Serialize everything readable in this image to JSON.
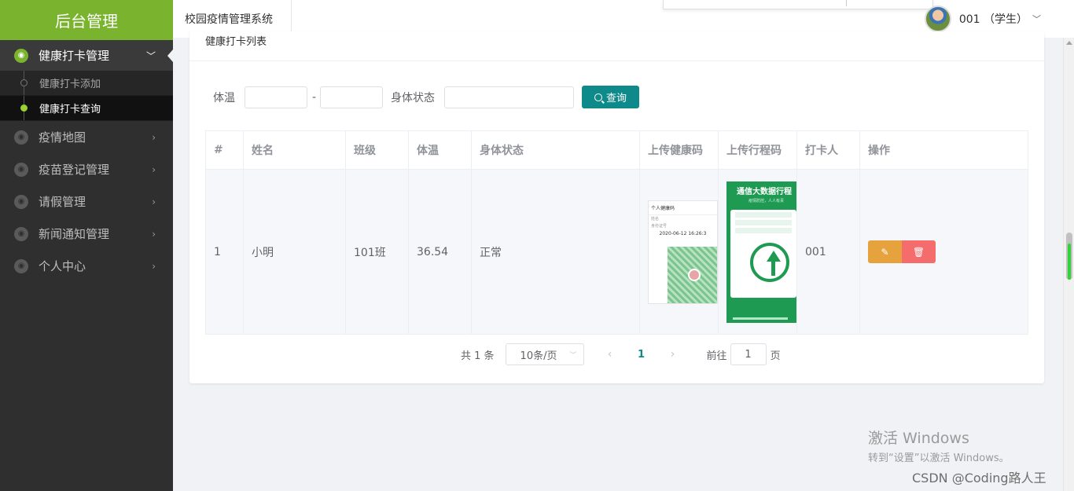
{
  "sidebar": {
    "brand": "后台管理",
    "menu": [
      {
        "label": "健康打卡管理",
        "active": true,
        "expanded": true,
        "children": [
          {
            "label": "健康打卡添加",
            "active": false
          },
          {
            "label": "健康打卡查询",
            "active": true
          }
        ]
      },
      {
        "label": "疫情地图"
      },
      {
        "label": "疫苗登记管理"
      },
      {
        "label": "请假管理"
      },
      {
        "label": "新闻通知管理"
      },
      {
        "label": "个人中心"
      }
    ]
  },
  "header": {
    "title": "校园疫情管理系统",
    "user": "001 （学生）"
  },
  "card": {
    "title": "健康打卡列表"
  },
  "filter": {
    "temp_label": "体温",
    "temp_min": "",
    "temp_max": "",
    "dash": "-",
    "status_label": "身体状态",
    "status_value": "",
    "search_label": "查询"
  },
  "table": {
    "columns": [
      "#",
      "姓名",
      "班级",
      "体温",
      "身体状态",
      "上传健康码",
      "上传行程码",
      "打卡人",
      "操作"
    ],
    "rows": [
      {
        "index": "1",
        "name": "小明",
        "class": "101班",
        "temp": "36.54",
        "status": "正常",
        "health_img": {
          "title": "个人健康码",
          "line1": "姓名",
          "line2": "身份证号",
          "date": "2020-06-12 16:26:3"
        },
        "trip_img": {
          "title": "通信大数据行程",
          "subtitle": "疫情防控，人人有责"
        },
        "checker": "001"
      }
    ]
  },
  "pagination": {
    "total": "共 1 条",
    "page_size": "10条/页",
    "prev": "‹",
    "current": "1",
    "next": "›",
    "goto_label": "前往",
    "goto_value": "1",
    "page_suffix": "页"
  },
  "watermark": {
    "activate_title": "激活 Windows",
    "activate_sub": "转到“设置”以激活 Windows。",
    "csdn": "CSDN @Coding路人王"
  }
}
